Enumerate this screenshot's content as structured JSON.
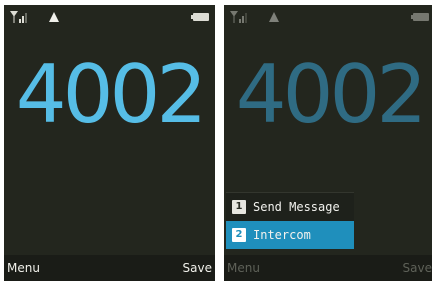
{
  "screens": [
    {
      "number": "4002",
      "softkeys": {
        "left": "Menu",
        "right": "Save"
      }
    },
    {
      "number": "4002",
      "softkeys": {
        "left": "Menu",
        "right": "Save"
      },
      "menu": {
        "items": [
          {
            "index": "1",
            "label": "Send Message",
            "selected": false
          },
          {
            "index": "2",
            "label": "Intercom",
            "selected": true
          }
        ]
      }
    }
  ],
  "status_icons": [
    "signal-icon",
    "alert-icon",
    "battery-icon"
  ],
  "colors": {
    "screen_bg": "#23261e",
    "number_active": "#56bde6",
    "number_dimmed": "#2f6b83",
    "menu_highlight": "#1f8fbc"
  }
}
